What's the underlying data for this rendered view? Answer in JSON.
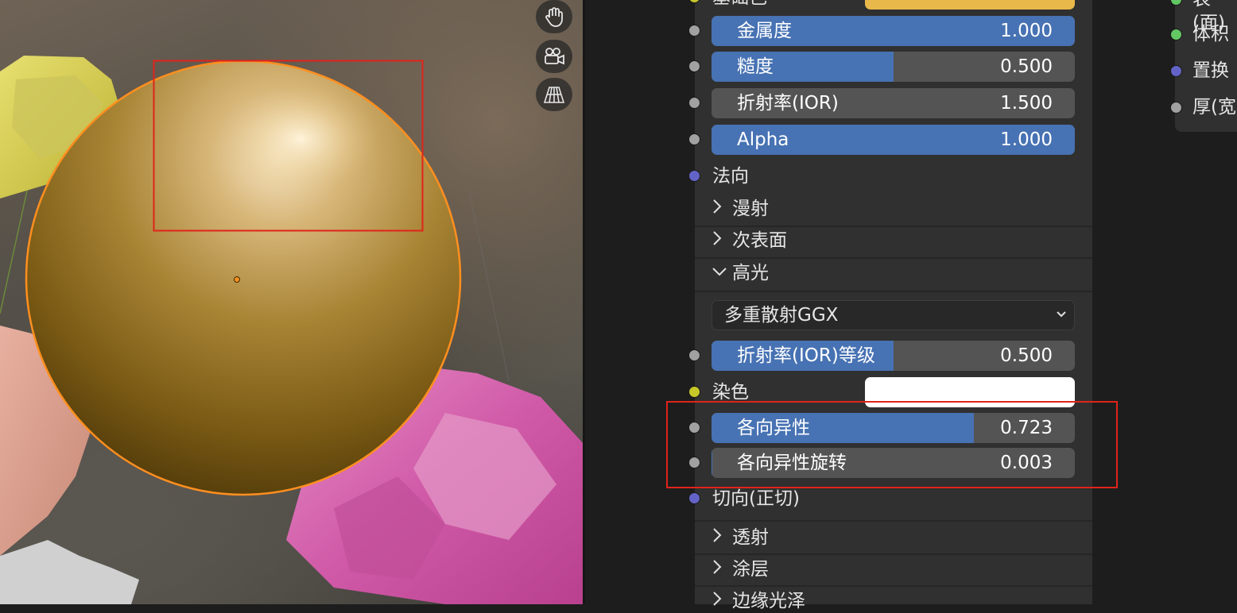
{
  "viewport": {
    "gizmos": [
      "hand-pan-icon",
      "camera-icon",
      "perspective-grid-icon"
    ]
  },
  "node": {
    "top_partial_label": "基础色",
    "sliders_top": [
      {
        "label": "金属度",
        "value": "1.000",
        "fill": 1.0
      },
      {
        "label": "糙度",
        "value": "0.500",
        "fill": 0.5
      },
      {
        "label": "折射率(IOR)",
        "value": "1.500",
        "fill": 0.0
      },
      {
        "label": "Alpha",
        "value": "1.000",
        "fill": 1.0
      }
    ],
    "normal_label": "法向",
    "panels_collapsed_top": [
      "漫射",
      "次表面"
    ],
    "panel_expanded": "高光",
    "distribution_select": "多重散射GGX",
    "ior_level": {
      "label": "折射率(IOR)等级",
      "value": "0.500",
      "fill": 0.5
    },
    "tint_label": "染色",
    "tint_color": "#ffffff",
    "anisotropic": {
      "label": "各向异性",
      "value": "0.723",
      "fill": 0.723
    },
    "anisotropic_rotation": {
      "label": "各向异性旋转",
      "value": "0.003",
      "fill": 0.003
    },
    "tangent_label": "切向(正切)",
    "panels_collapsed_bottom": [
      "透射",
      "涂层",
      "边缘光泽"
    ]
  },
  "output_node": {
    "items": [
      "表(面)",
      "体积",
      "置换",
      "厚(宽"
    ]
  },
  "colors": {
    "slider_fill": "#4772b3",
    "slider_bg": "#545454",
    "socket_gray": "#a1a1a1",
    "socket_blue": "#6363c7",
    "socket_yellow": "#c7c729",
    "socket_green": "#63c763",
    "base_color_swatch": "#e8b84a",
    "highlight": "#e0231b",
    "selection_outline": "#ff8f1f"
  }
}
